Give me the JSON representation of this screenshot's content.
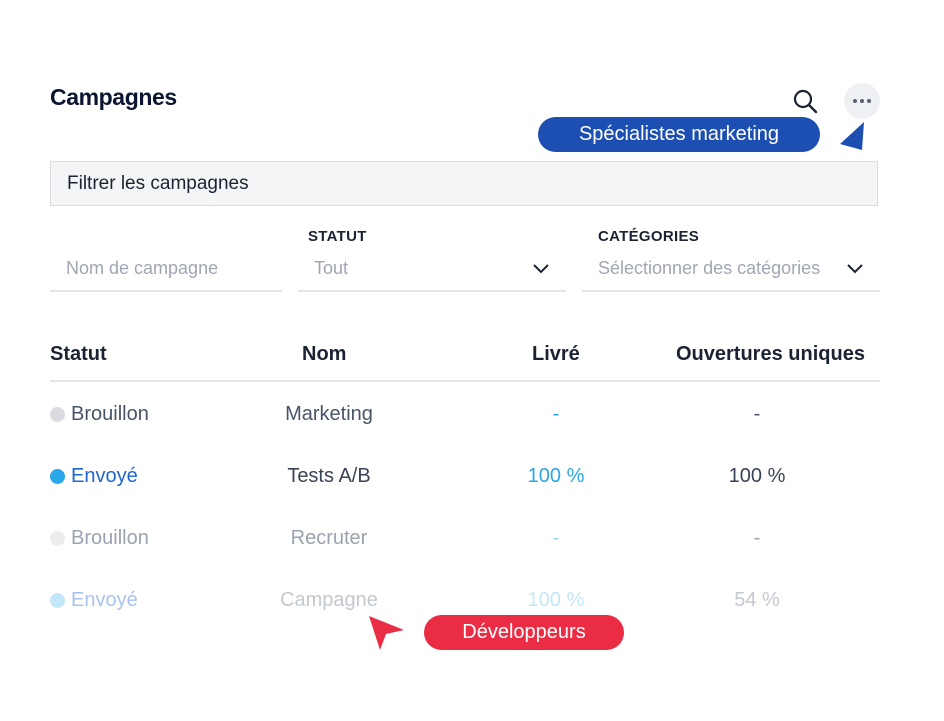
{
  "header": {
    "title": "Campagnes",
    "search_icon": "search-icon",
    "more_icon": "more-horizontal-icon"
  },
  "collaborators": {
    "marketing_label": "Spécialistes marketing",
    "marketing_color": "#1d4fb3",
    "developers_label": "Développeurs",
    "developers_color": "#ea2d45"
  },
  "filters": {
    "bar_label": "Filtrer les campagnes",
    "name_placeholder": "Nom de campagne",
    "status_label": "STATUT",
    "status_value": "Tout",
    "categories_label": "CATÉGORIES",
    "categories_placeholder": "Sélectionner des catégories"
  },
  "table": {
    "columns": [
      "Statut",
      "Nom",
      "Livré",
      "Ouvertures uniques"
    ],
    "rows": [
      {
        "status": "Brouillon",
        "name": "Marketing",
        "delivered": "-",
        "unique_opens": "-"
      },
      {
        "status": "Envoyé",
        "name": "Tests A/B",
        "delivered": "100 %",
        "unique_opens": "100 %"
      },
      {
        "status": "Brouillon",
        "name": "Recruter",
        "delivered": "-",
        "unique_opens": "-"
      },
      {
        "status": "Envoyé",
        "name": "Campagne",
        "delivered": "100 %",
        "unique_opens": "54 %"
      }
    ]
  },
  "colors": {
    "sent_status": "#1f66d1",
    "delivered": "#2aa7e8",
    "draft_dot": "#d9dbe0"
  }
}
